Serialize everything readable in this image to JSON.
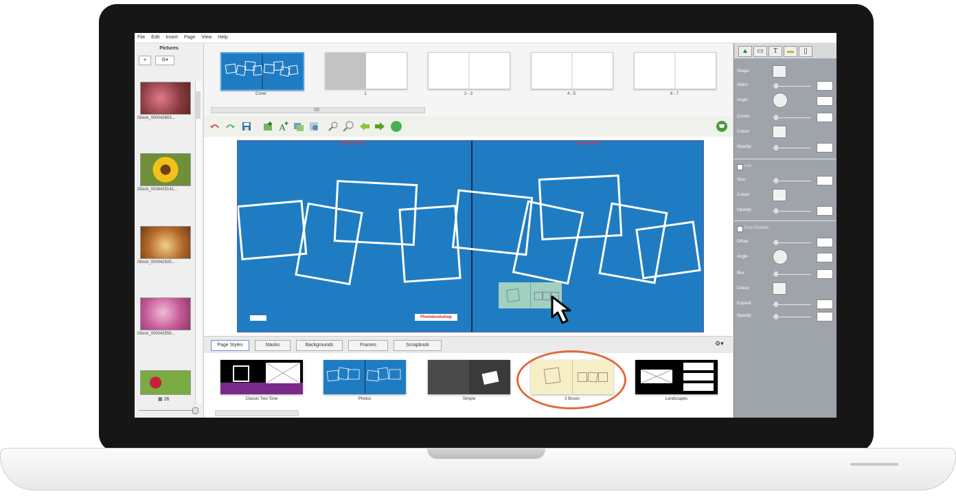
{
  "menu": [
    "File",
    "Edit",
    "Insert",
    "Page",
    "View",
    "Help"
  ],
  "pictures": {
    "title": "Pictures",
    "add_label": "+",
    "gear_label": "⚙▾",
    "items": [
      {
        "name": "iStock_000042803...",
        "color": "#b4566a"
      },
      {
        "name": "iStock_0008425141...",
        "color": "#e3b11a"
      },
      {
        "name": "iStock_000042925...",
        "color": "#c67a32"
      },
      {
        "name": "iStock_000042556...",
        "color": "#d27aa8"
      },
      {
        "name": "",
        "color": "#7aaa42"
      }
    ],
    "count": "26"
  },
  "pages": [
    {
      "label": "Cover"
    },
    {
      "label": "1"
    },
    {
      "label": "2 - 3"
    },
    {
      "label": "4 - 5"
    },
    {
      "label": "6 - 7"
    }
  ],
  "toolbar": {
    "icons": [
      "undo-icon",
      "redo-icon",
      "save-icon",
      "add-picture-icon",
      "add-text-icon",
      "arrange-icon",
      "crop-icon",
      "zoom-out-icon",
      "zoom-in-icon",
      "previous-page-icon",
      "next-page-icon",
      "help-icon",
      "cart-icon"
    ]
  },
  "canvas": {
    "brand": "Photobookshop"
  },
  "tabs": [
    "Page Styles",
    "Masks",
    "Backgrounds",
    "Frames",
    "Scrapbook"
  ],
  "styles": [
    {
      "label": "Classic Two Tone"
    },
    {
      "label": "Photos"
    },
    {
      "label": "Simple"
    },
    {
      "label": "3 Boxes"
    },
    {
      "label": "Landscapes"
    }
  ],
  "properties": {
    "tabs": [
      "▲",
      "▭",
      "T",
      "▬",
      "▯"
    ],
    "shape_labels": [
      "Shape:",
      "Sides:",
      "Angle:",
      "Corner:",
      "Colour:",
      "Opacity:"
    ],
    "line_check": "Line",
    "line_labels": [
      "Size:",
      "Colour:",
      "Opacity:"
    ],
    "shadow_check": "Drop Shadow",
    "shadow_labels": [
      "Offset:",
      "Angle:",
      "Blur:",
      "Colour:",
      "Expand:",
      "Opacity:"
    ]
  },
  "colors": {
    "spread_blue": "#1f7cc3",
    "highlight": "#e4683a"
  }
}
